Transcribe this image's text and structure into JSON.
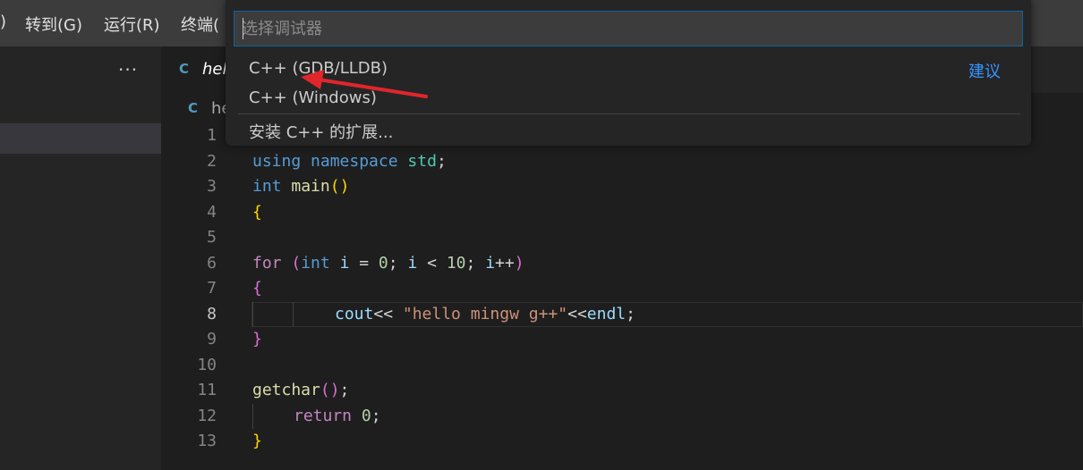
{
  "menubar": {
    "items": [
      {
        "label": ")"
      },
      {
        "label": "转到(G)"
      },
      {
        "label": "运行(R)"
      },
      {
        "label": "终端("
      }
    ]
  },
  "sidebar": {
    "more_icon": "ellipsis-icon"
  },
  "tab": {
    "filename": "hel",
    "icon": "cpp-file-icon"
  },
  "breadcrumb": {
    "filename": "he",
    "icon": "cpp-file-icon"
  },
  "quickpick": {
    "placeholder": "选择调试器",
    "value": "",
    "items": [
      {
        "label": "C++ (GDB/LLDB)",
        "tag": "建议"
      },
      {
        "label": "C++ (Windows)"
      },
      {
        "label": "安装 C++ 的扩展..."
      }
    ]
  },
  "annotation": {
    "arrow_color": "#e0262b"
  },
  "editor": {
    "current_line": 8,
    "lines": [
      {
        "n": "1"
      },
      {
        "n": "2",
        "t": [
          "using",
          " ",
          "namespace",
          " ",
          "std",
          ";"
        ]
      },
      {
        "n": "3",
        "t": [
          "int",
          " ",
          "main",
          "(",
          ")"
        ]
      },
      {
        "n": "4",
        "t": [
          "{"
        ]
      },
      {
        "n": "5"
      },
      {
        "n": "6",
        "t": [
          "for",
          " ",
          "(",
          "int",
          " ",
          "i",
          " = ",
          "0",
          "; ",
          "i",
          " < ",
          "10",
          "; ",
          "i",
          "++",
          ")"
        ]
      },
      {
        "n": "7",
        "t": [
          "{"
        ]
      },
      {
        "n": "8",
        "t": [
          "cout",
          "<< ",
          "\"hello mingw g++\"",
          "<<",
          "endl",
          ";"
        ]
      },
      {
        "n": "9",
        "t": [
          "}"
        ]
      },
      {
        "n": "10"
      },
      {
        "n": "11",
        "t": [
          "getchar",
          "(",
          ")",
          ";"
        ]
      },
      {
        "n": "12",
        "t": [
          "return",
          " ",
          "0",
          ";"
        ]
      },
      {
        "n": "13",
        "t": [
          "}"
        ]
      }
    ]
  }
}
